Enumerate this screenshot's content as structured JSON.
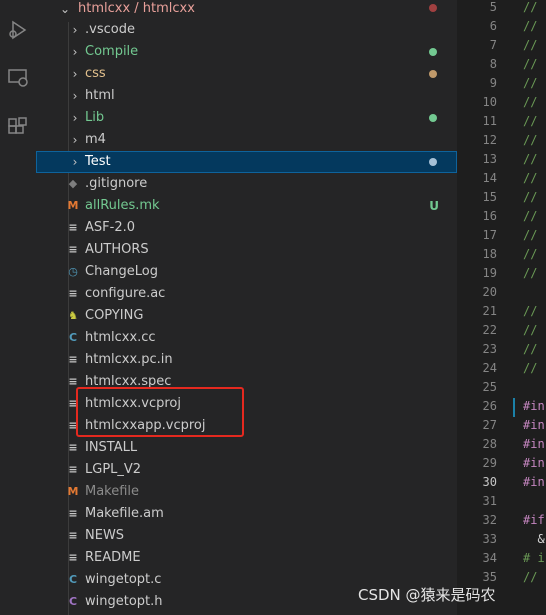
{
  "activity_bar": [
    {
      "name": "run-debug-icon"
    },
    {
      "name": "remote-explorer-icon"
    },
    {
      "name": "extensions-icon"
    }
  ],
  "explorer": {
    "root_label": "htmlcxx / htmlcxx",
    "items": [
      {
        "label": ".vscode",
        "type": "folder",
        "color": "#cccccc"
      },
      {
        "label": "Compile",
        "type": "folder",
        "color": "#73c991",
        "dot": "#73c991"
      },
      {
        "label": "css",
        "type": "folder",
        "color": "#e2c08d",
        "dot": "#c09a6b"
      },
      {
        "label": "html",
        "type": "folder",
        "color": "#cccccc"
      },
      {
        "label": "Lib",
        "type": "folder",
        "color": "#73c991",
        "dot": "#73c991"
      },
      {
        "label": "m4",
        "type": "folder",
        "color": "#cccccc"
      },
      {
        "label": "Test",
        "type": "folder",
        "color": "#ffffff",
        "selected": true,
        "dot": "#a6c0d6"
      },
      {
        "label": ".gitignore",
        "type": "file",
        "icon": "git-icon",
        "color": "#cccccc"
      },
      {
        "label": "allRules.mk",
        "type": "file",
        "icon": "makefile-icon",
        "color": "#73c991",
        "status": "U"
      },
      {
        "label": "ASF-2.0",
        "type": "file",
        "icon": "text-file-icon",
        "color": "#cccccc"
      },
      {
        "label": "AUTHORS",
        "type": "file",
        "icon": "text-file-icon",
        "color": "#cccccc"
      },
      {
        "label": "ChangeLog",
        "type": "file",
        "icon": "clock-icon",
        "color": "#cccccc"
      },
      {
        "label": "configure.ac",
        "type": "file",
        "icon": "text-file-icon",
        "color": "#cccccc"
      },
      {
        "label": "COPYING",
        "type": "file",
        "icon": "license-icon",
        "color": "#cccccc"
      },
      {
        "label": "htmlcxx.cc",
        "type": "file",
        "icon": "cpp-icon",
        "color": "#cccccc"
      },
      {
        "label": "htmlcxx.pc.in",
        "type": "file",
        "icon": "text-file-icon",
        "color": "#cccccc"
      },
      {
        "label": "htmlcxx.spec",
        "type": "file",
        "icon": "text-file-icon",
        "color": "#cccccc"
      },
      {
        "label": "htmlcxx.vcproj",
        "type": "file",
        "icon": "text-file-icon",
        "color": "#cccccc"
      },
      {
        "label": "htmlcxxapp.vcproj",
        "type": "file",
        "icon": "text-file-icon",
        "color": "#cccccc"
      },
      {
        "label": "INSTALL",
        "type": "file",
        "icon": "text-file-icon",
        "color": "#cccccc"
      },
      {
        "label": "LGPL_V2",
        "type": "file",
        "icon": "text-file-icon",
        "color": "#cccccc"
      },
      {
        "label": "Makefile",
        "type": "file",
        "icon": "makefile-icon",
        "color": "#8b8b8b"
      },
      {
        "label": "Makefile.am",
        "type": "file",
        "icon": "text-file-icon",
        "color": "#cccccc"
      },
      {
        "label": "NEWS",
        "type": "file",
        "icon": "text-file-icon",
        "color": "#cccccc"
      },
      {
        "label": "README",
        "type": "file",
        "icon": "text-file-icon",
        "color": "#cccccc"
      },
      {
        "label": "wingetopt.c",
        "type": "file",
        "icon": "c-icon",
        "color": "#cccccc"
      },
      {
        "label": "wingetopt.h",
        "type": "file",
        "icon": "c-header-icon",
        "color": "#cccccc"
      }
    ]
  },
  "editor": {
    "active_line": "30",
    "lines": [
      {
        "n": "5",
        "text": "//",
        "kind": "comment"
      },
      {
        "n": "6",
        "text": "//",
        "kind": "comment"
      },
      {
        "n": "7",
        "text": "//",
        "kind": "comment"
      },
      {
        "n": "8",
        "text": "//",
        "kind": "comment"
      },
      {
        "n": "9",
        "text": "//",
        "kind": "comment"
      },
      {
        "n": "10",
        "text": "//",
        "kind": "comment"
      },
      {
        "n": "11",
        "text": "//",
        "kind": "comment"
      },
      {
        "n": "12",
        "text": "//",
        "kind": "comment"
      },
      {
        "n": "13",
        "text": "//",
        "kind": "comment"
      },
      {
        "n": "14",
        "text": "//",
        "kind": "comment"
      },
      {
        "n": "15",
        "text": "//",
        "kind": "comment"
      },
      {
        "n": "16",
        "text": "//",
        "kind": "comment"
      },
      {
        "n": "17",
        "text": "//",
        "kind": "comment"
      },
      {
        "n": "18",
        "text": "//",
        "kind": "comment"
      },
      {
        "n": "19",
        "text": "//",
        "kind": "comment"
      },
      {
        "n": "20",
        "text": "",
        "kind": "plain"
      },
      {
        "n": "21",
        "text": "//",
        "kind": "comment"
      },
      {
        "n": "22",
        "text": "//",
        "kind": "comment"
      },
      {
        "n": "23",
        "text": "//",
        "kind": "comment"
      },
      {
        "n": "24",
        "text": "//",
        "kind": "comment"
      },
      {
        "n": "25",
        "text": "",
        "kind": "plain"
      },
      {
        "n": "26",
        "text": "#in",
        "kind": "directive"
      },
      {
        "n": "27",
        "text": "#in",
        "kind": "directive"
      },
      {
        "n": "28",
        "text": "#in",
        "kind": "directive"
      },
      {
        "n": "29",
        "text": "#in",
        "kind": "directive"
      },
      {
        "n": "30",
        "text": "#in",
        "kind": "directive"
      },
      {
        "n": "31",
        "text": "",
        "kind": "plain"
      },
      {
        "n": "32",
        "text": "#if",
        "kind": "directive"
      },
      {
        "n": "33",
        "text": "  &",
        "kind": "plain"
      },
      {
        "n": "34",
        "text": "# i",
        "kind": "comment"
      },
      {
        "n": "35",
        "text": "//",
        "kind": "comment"
      }
    ]
  },
  "watermark": "CSDN @猿来是码农"
}
